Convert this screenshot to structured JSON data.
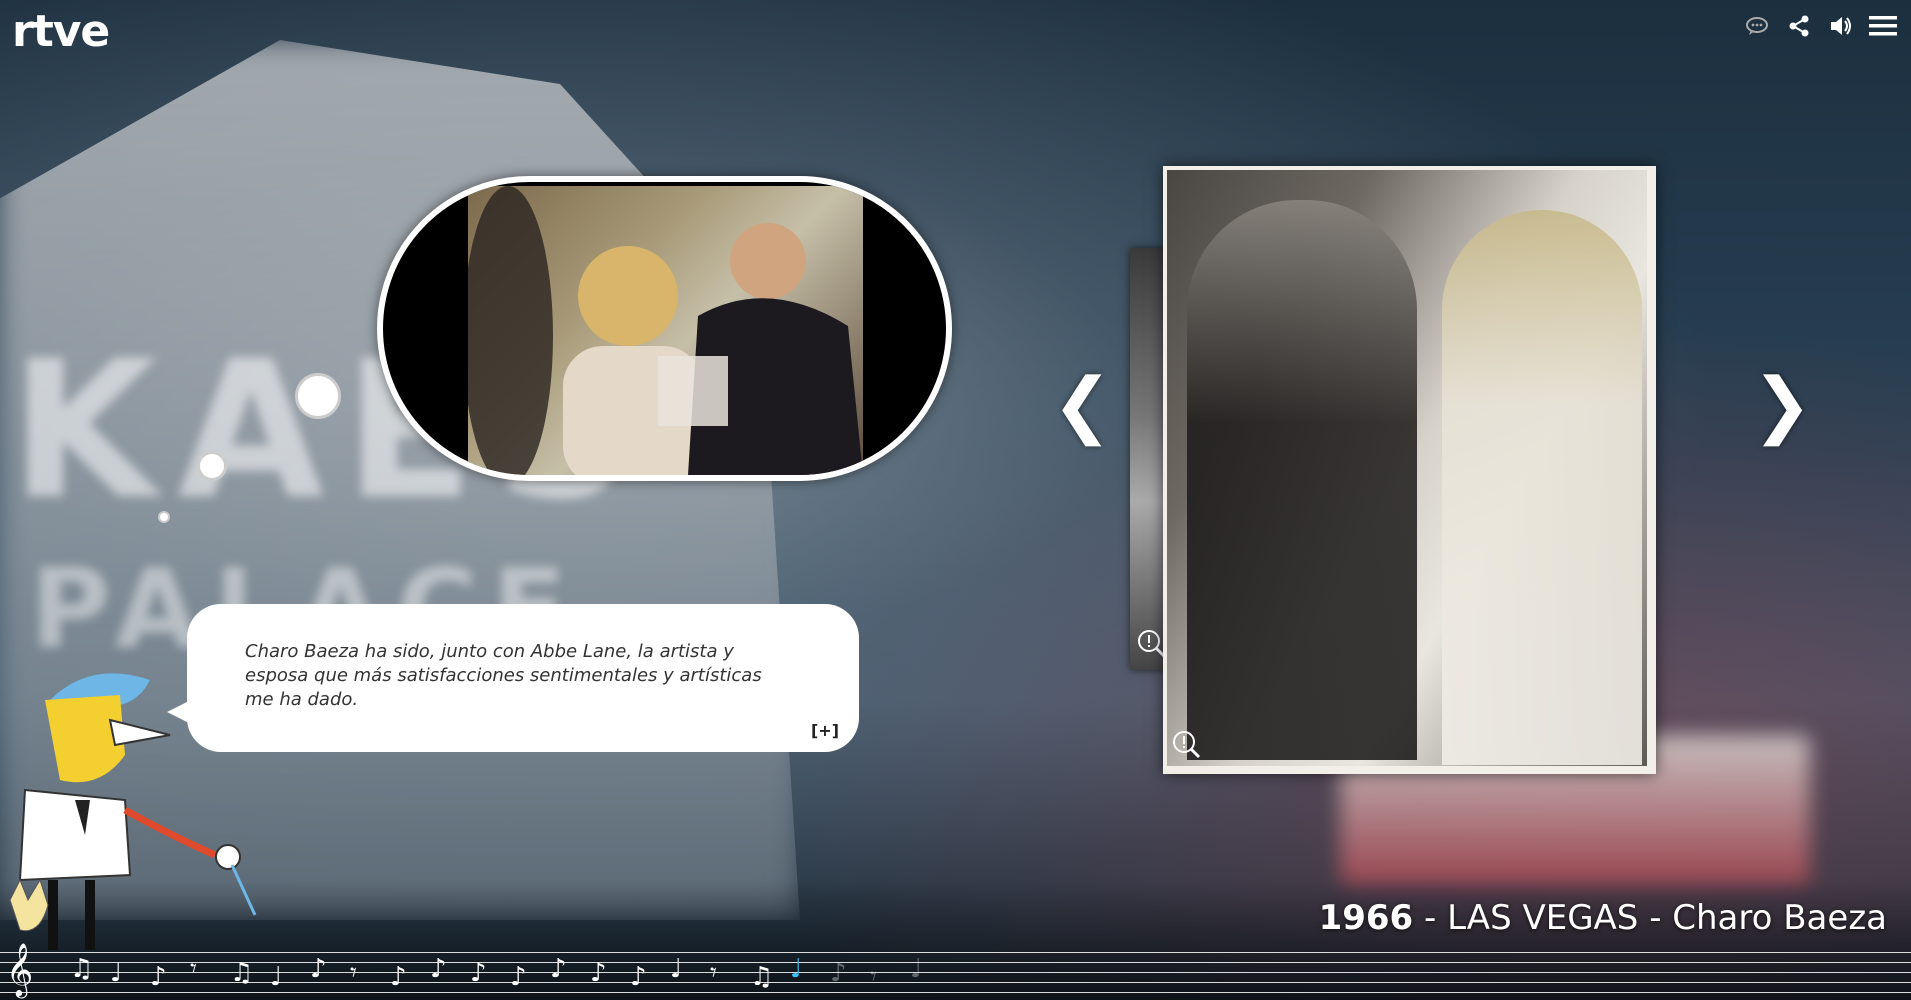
{
  "header": {
    "logo": "rtve",
    "icons": [
      "chat-icon",
      "share-icon",
      "volume-icon",
      "menu-icon"
    ]
  },
  "video": {
    "description_icon": "video-thumbnail"
  },
  "quote": {
    "text": "Charo Baeza ha sido, junto con Abbe Lane, la artista y esposa que más satisfacciones sentimentales y artísticas me ha dado.",
    "more_label": "[+]"
  },
  "gallery": {
    "prev_label": "❮",
    "next_label": "❯"
  },
  "caption": {
    "year": "1966",
    "rest": " - LAS VEGAS - Charo Baeza"
  },
  "timeline": {
    "notes": [
      "♫",
      "♩",
      "♪",
      "𝄾",
      "♫",
      "♩",
      "♪",
      "𝄾",
      "♪",
      "♪",
      "♪",
      "♪",
      "♪",
      "♪",
      "♪",
      "♩",
      "𝄾",
      "♫",
      "♩",
      "♪",
      "𝄾",
      "♩"
    ],
    "active_index": 18
  },
  "colors": {
    "accent_note": "#3fc1ff",
    "bubble": "#ffffff"
  }
}
